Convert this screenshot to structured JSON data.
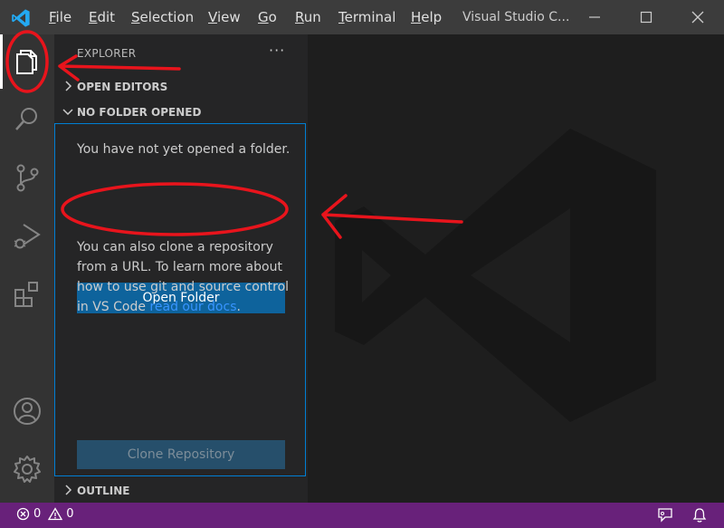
{
  "titlebar": {
    "menu": [
      {
        "label": "File",
        "accel": "F",
        "rest": "ile"
      },
      {
        "label": "Edit",
        "accel": "E",
        "rest": "dit"
      },
      {
        "label": "Selection",
        "accel": "S",
        "rest": "election"
      },
      {
        "label": "View",
        "accel": "V",
        "rest": "iew"
      },
      {
        "label": "Go",
        "accel": "G",
        "rest": "o"
      },
      {
        "label": "Run",
        "accel": "R",
        "rest": "un"
      },
      {
        "label": "Terminal",
        "accel": "T",
        "rest": "erminal"
      },
      {
        "label": "Help",
        "accel": "H",
        "rest": "elp"
      }
    ],
    "window_title": "Visual Studio C..."
  },
  "activitybar": {
    "icons": [
      "explorer-icon",
      "search-icon",
      "source-control-icon",
      "run-debug-icon",
      "extensions-icon",
      "accounts-icon",
      "manage-gear-icon"
    ]
  },
  "sidebar": {
    "title": "EXPLORER",
    "more": "···",
    "sections": {
      "open_editors": "OPEN EDITORS",
      "no_folder": "NO FOLDER OPENED",
      "outline": "OUTLINE"
    },
    "no_folder_text": "You have not yet opened a folder.",
    "open_folder_button": "Open Folder",
    "clone_text_before": "You can also clone a repository from a URL. To learn more about how to use git and source control in VS Code ",
    "clone_link": "read our docs",
    "clone_text_after": ".",
    "clone_button": "Clone Repository"
  },
  "statusbar": {
    "errors": "0",
    "warnings": "0"
  },
  "colors": {
    "titlebar": "#3c3c3c",
    "activitybar": "#333333",
    "sidebar": "#252526",
    "editor": "#1e1e1e",
    "statusbar": "#68217a",
    "primary_button": "#0e639c",
    "focus_border": "#007fd4",
    "annotation": "#e8141c"
  }
}
